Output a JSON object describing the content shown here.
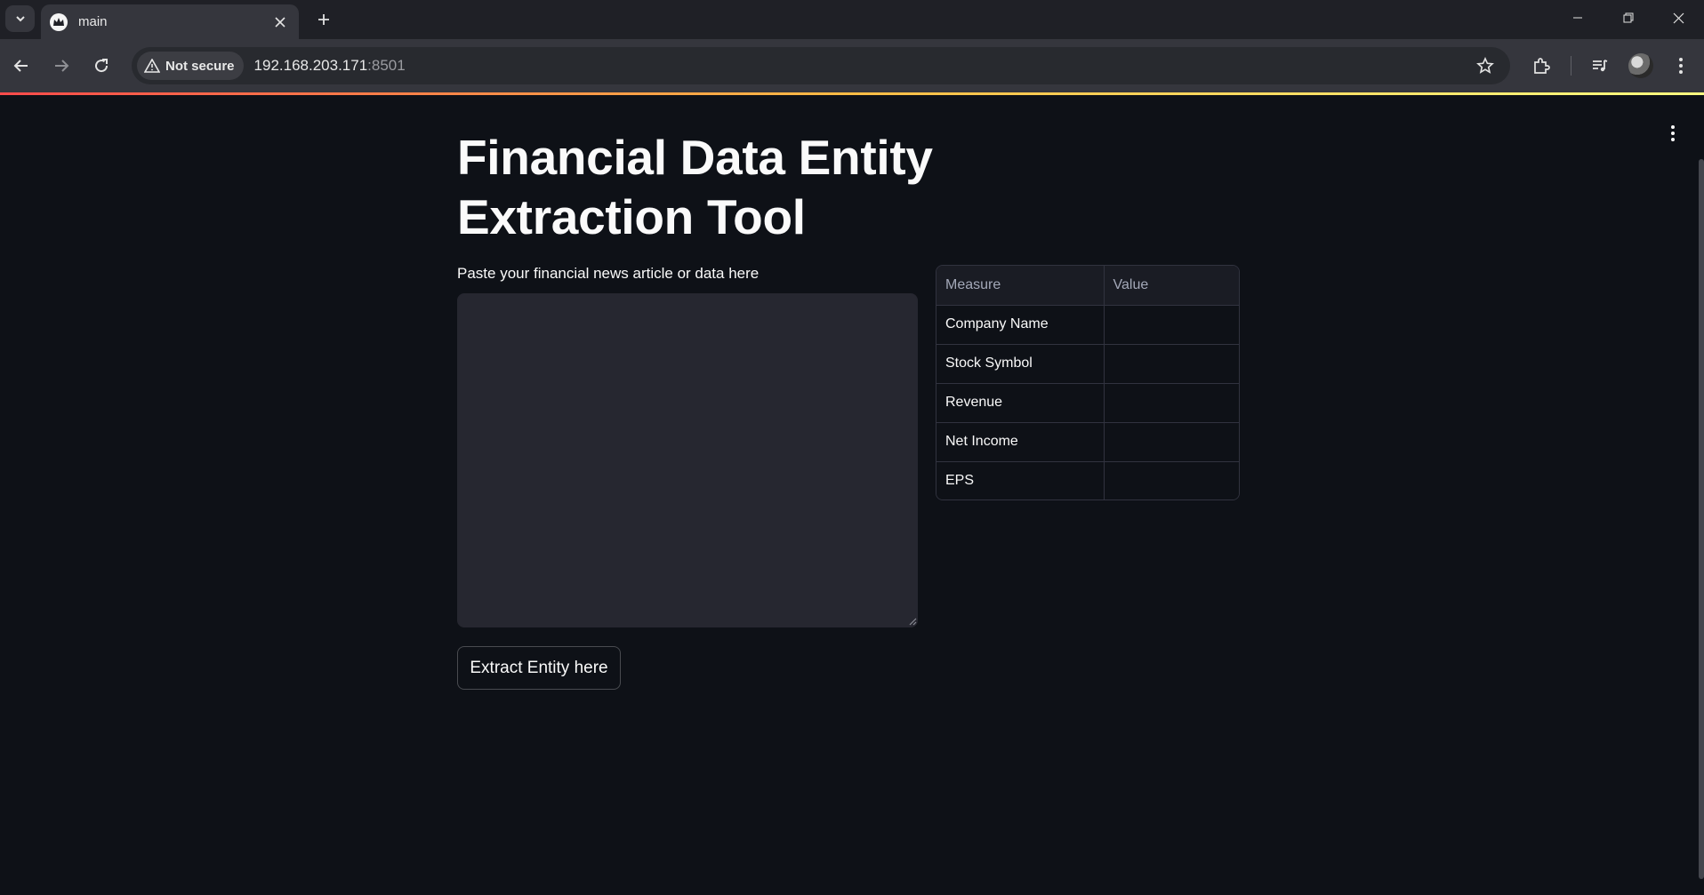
{
  "browser": {
    "tab_title": "main",
    "security_label": "Not secure",
    "url_host": "192.168.203.171",
    "url_port": ":8501"
  },
  "app": {
    "title_line1": "Financial Data Entity",
    "title_line2": "Extraction Tool",
    "input_label": "Paste your financial news article or data here",
    "input_value": "",
    "extract_button": "Extract Entity here",
    "table": {
      "headers": [
        "Measure",
        "Value"
      ],
      "rows": [
        [
          "Company Name",
          ""
        ],
        [
          "Stock Symbol",
          ""
        ],
        [
          "Revenue",
          ""
        ],
        [
          "Net Income",
          ""
        ],
        [
          "EPS",
          ""
        ]
      ]
    }
  },
  "colors": {
    "background": "#0e1117",
    "input_background": "#262730",
    "text": "#fafafa",
    "decoration_start": "#ff4b4b",
    "decoration_end": "#fffd80"
  }
}
